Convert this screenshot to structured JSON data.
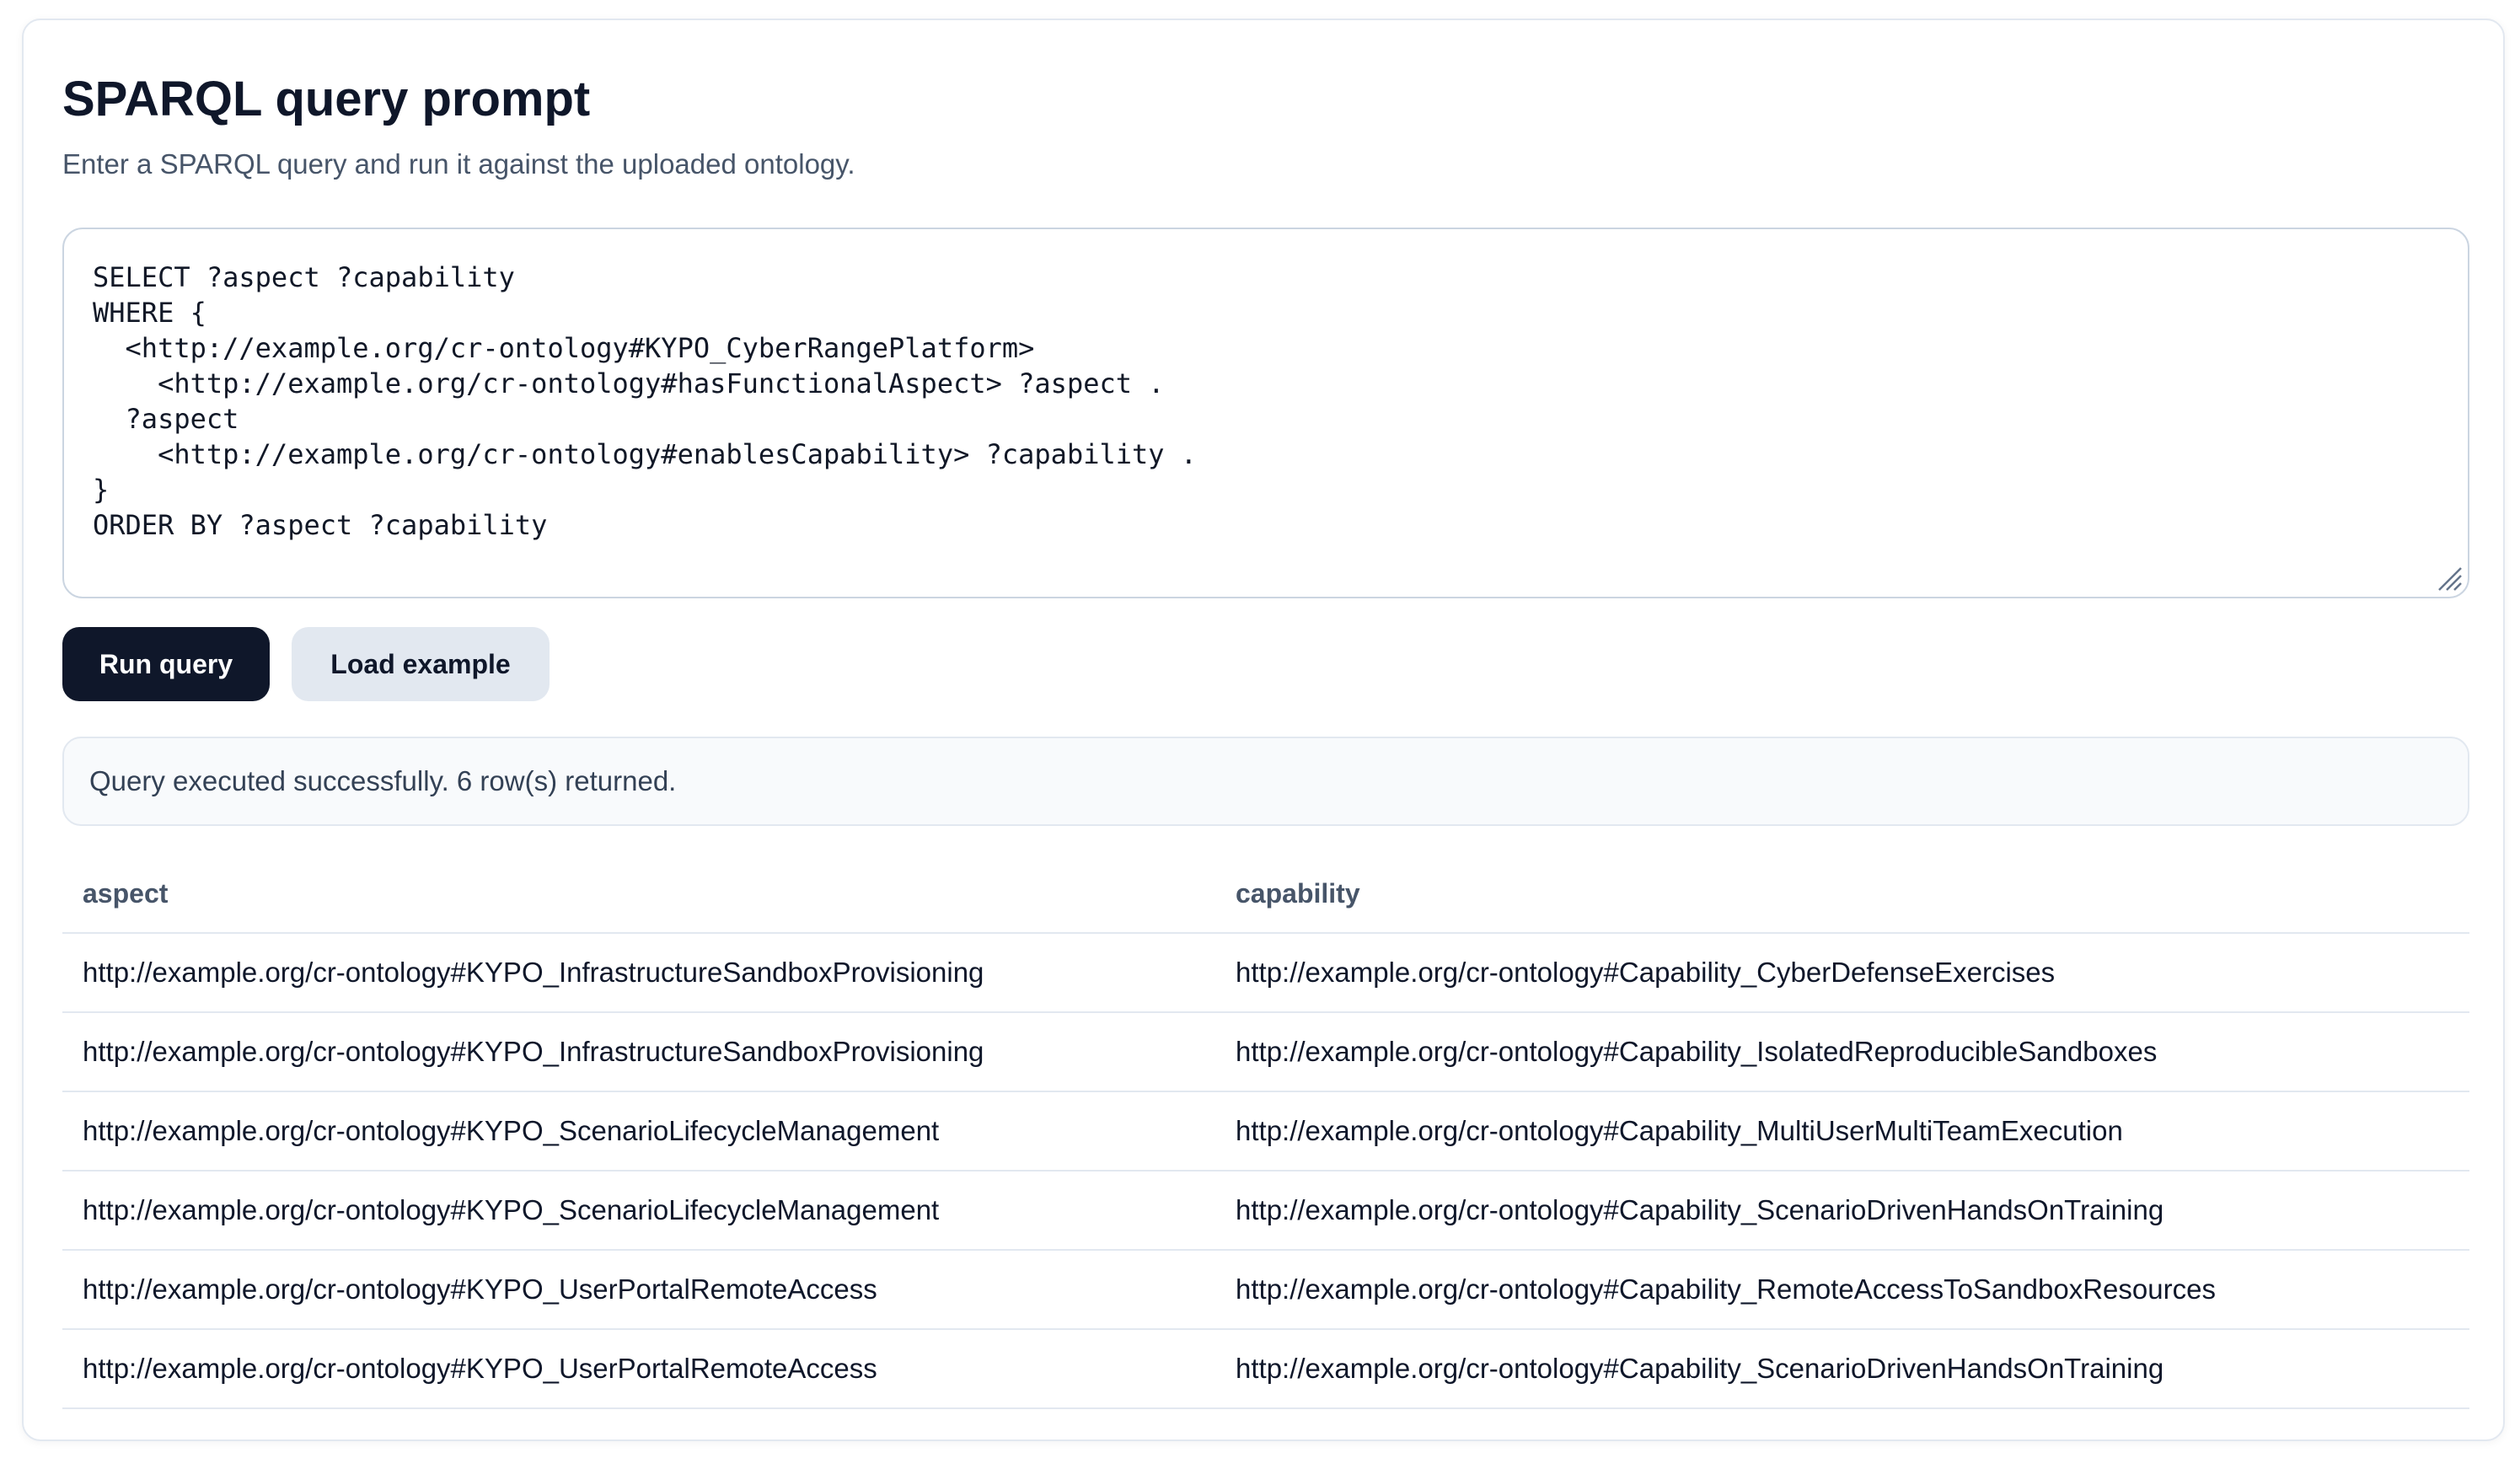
{
  "page": {
    "title": "SPARQL query prompt",
    "subtitle": "Enter a SPARQL query and run it against the uploaded ontology."
  },
  "editor": {
    "query": "SELECT ?aspect ?capability\nWHERE {\n  <http://example.org/cr-ontology#KYPO_CyberRangePlatform>\n    <http://example.org/cr-ontology#hasFunctionalAspect> ?aspect .\n  ?aspect\n    <http://example.org/cr-ontology#enablesCapability> ?capability .\n}\nORDER BY ?aspect ?capability"
  },
  "buttons": {
    "run_label": "Run query",
    "load_label": "Load example"
  },
  "status": {
    "message": "Query executed successfully. 6 row(s) returned."
  },
  "results": {
    "columns": [
      "aspect",
      "capability"
    ],
    "rows": [
      [
        "http://example.org/cr-ontology#KYPO_InfrastructureSandboxProvisioning",
        "http://example.org/cr-ontology#Capability_CyberDefenseExercises"
      ],
      [
        "http://example.org/cr-ontology#KYPO_InfrastructureSandboxProvisioning",
        "http://example.org/cr-ontology#Capability_IsolatedReproducibleSandboxes"
      ],
      [
        "http://example.org/cr-ontology#KYPO_ScenarioLifecycleManagement",
        "http://example.org/cr-ontology#Capability_MultiUserMultiTeamExecution"
      ],
      [
        "http://example.org/cr-ontology#KYPO_ScenarioLifecycleManagement",
        "http://example.org/cr-ontology#Capability_ScenarioDrivenHandsOnTraining"
      ],
      [
        "http://example.org/cr-ontology#KYPO_UserPortalRemoteAccess",
        "http://example.org/cr-ontology#Capability_RemoteAccessToSandboxResources"
      ],
      [
        "http://example.org/cr-ontology#KYPO_UserPortalRemoteAccess",
        "http://example.org/cr-ontology#Capability_ScenarioDrivenHandsOnTraining"
      ]
    ]
  }
}
